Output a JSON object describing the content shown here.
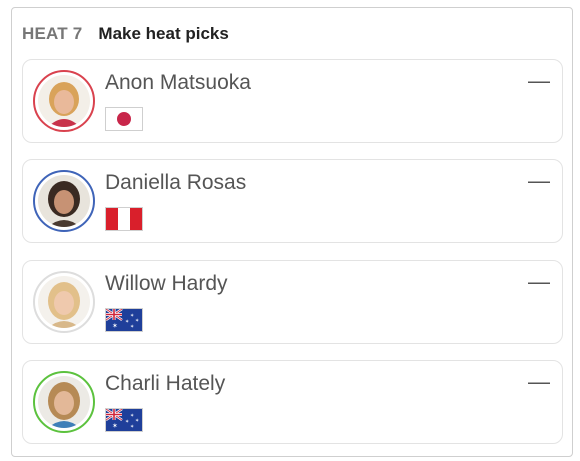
{
  "heat": {
    "label": "HEAT 7",
    "title": "Make heat picks"
  },
  "surfers": [
    {
      "name": "Anon Matsuoka",
      "flag": "japan-flag",
      "ring_color": "#d9424e",
      "pick": "—"
    },
    {
      "name": "Daniella Rosas",
      "flag": "peru-flag",
      "ring_color": "#3f64b8",
      "pick": "—"
    },
    {
      "name": "Willow Hardy",
      "flag": "australia-flag",
      "ring_color": "#dddddd",
      "pick": "—"
    },
    {
      "name": "Charli Hately",
      "flag": "australia-flag",
      "ring_color": "#5cc23e",
      "pick": "—"
    }
  ]
}
